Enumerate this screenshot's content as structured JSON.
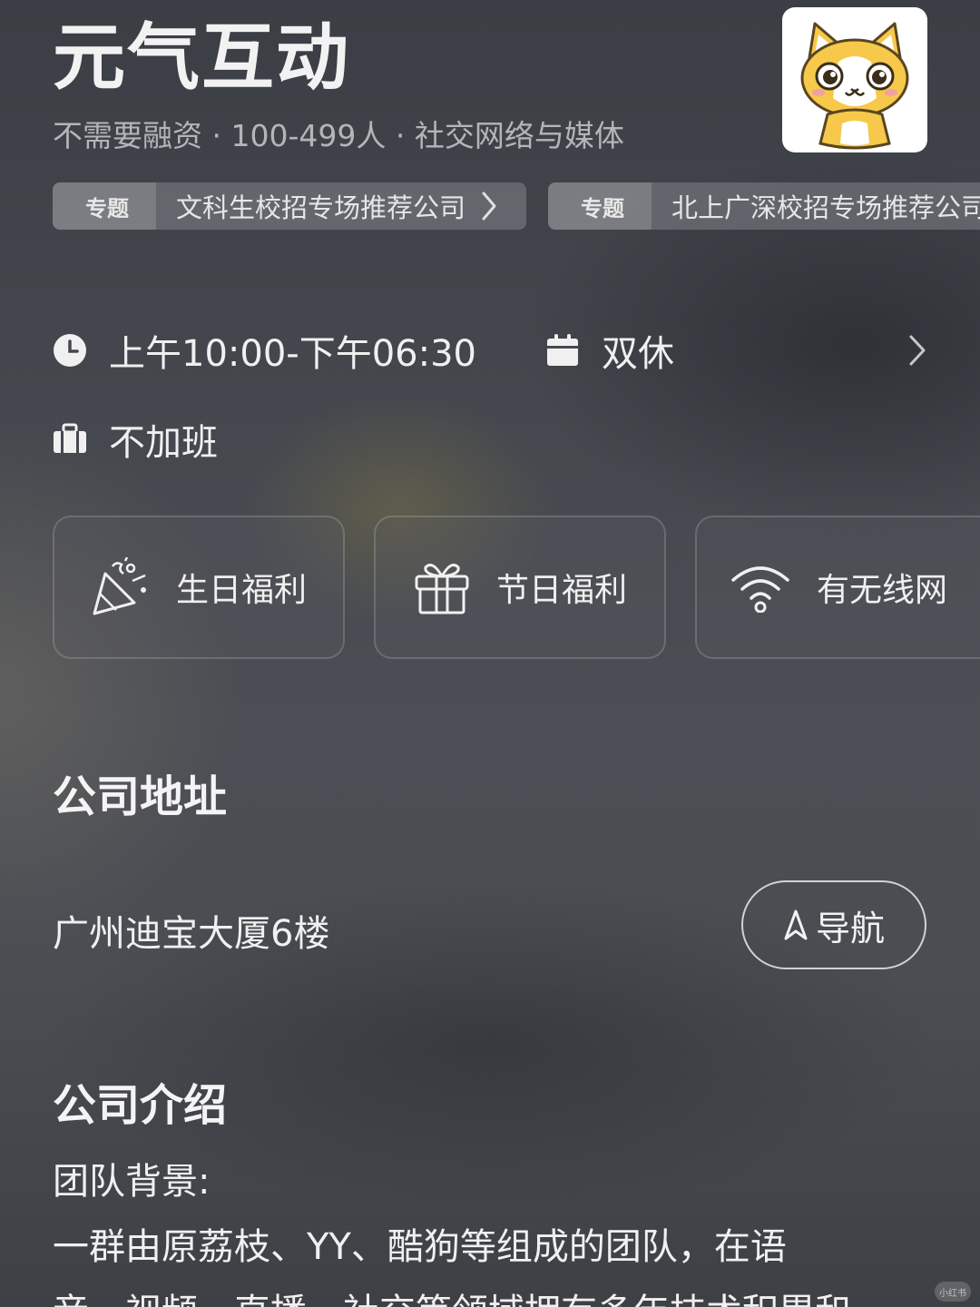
{
  "company": {
    "name": "元气互动",
    "meta": "不需要融资 · 100-499人 · 社交网络与媒体",
    "logo_icon": "cat-mascot-logo"
  },
  "topics": [
    {
      "tag": "专题",
      "label": "文科生校招专场推荐公司"
    },
    {
      "tag": "专题",
      "label": "北上广深校招专场推荐公司"
    }
  ],
  "work_info": {
    "hours": "上午10:00-下午06:30",
    "rest": "双休",
    "overtime": "不加班"
  },
  "benefits": [
    {
      "label": "生日福利",
      "icon": "party-popper-icon"
    },
    {
      "label": "节日福利",
      "icon": "gift-icon"
    },
    {
      "label": "有无线网",
      "icon": "wifi-icon"
    }
  ],
  "address_section": {
    "title": "公司地址",
    "address": "广州迪宝大厦6楼",
    "nav_label": "导航"
  },
  "intro_section": {
    "title": "公司介绍",
    "heading": "团队背景:",
    "line1": "一群由原荔枝、YY、酷狗等组成的团队，在语",
    "line2": "音、视频、直播、社交等领域拥有多年技术积累和"
  },
  "watermark": "小红书",
  "colors": {
    "background": "#45484e",
    "text_primary": "#f0f0f0",
    "text_secondary": "#b3b5b9",
    "chip_bg": "#8a8c91",
    "logo_yellow": "#f6c94a"
  }
}
